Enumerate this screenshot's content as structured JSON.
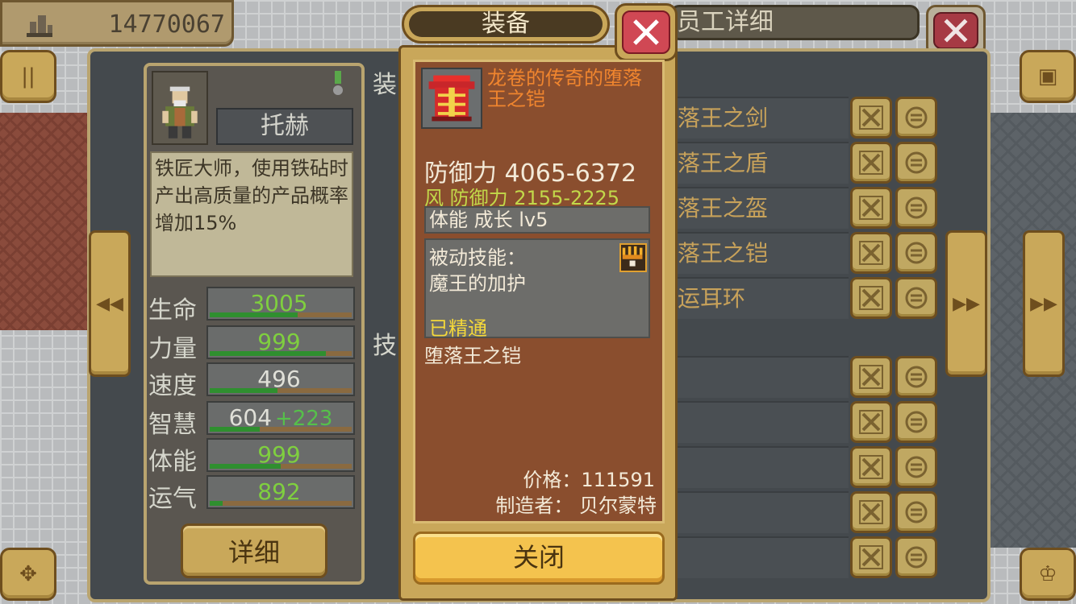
{
  "header": {
    "coins": "14770067",
    "right_panel_title": "员工详细"
  },
  "character": {
    "name": "托赫",
    "description": "铁匠大师，使用铁砧时产出高质量的产品概率增加15%",
    "stats": [
      {
        "label": "生命",
        "value": "3005",
        "bonus": "",
        "green": true,
        "fill": 0.62
      },
      {
        "label": "力量",
        "value": "999",
        "bonus": "",
        "green": true,
        "fill": 0.82
      },
      {
        "label": "速度",
        "value": "496",
        "bonus": "",
        "green": false,
        "fill": 0.48
      },
      {
        "label": "智慧",
        "value": "604",
        "bonus": "+223",
        "green": false,
        "fill": 0.35
      },
      {
        "label": "体能",
        "value": "999",
        "bonus": "",
        "green": true,
        "fill": 0.5
      },
      {
        "label": "运气",
        "value": "892",
        "bonus": "",
        "green": true,
        "fill": 0.09
      }
    ],
    "detail_button": "详细"
  },
  "sections": {
    "equipment_header": "装",
    "skills_header": "技"
  },
  "equipment_list": [
    "落王之剑",
    "落王之盾",
    "落王之盔",
    "落王之铠",
    "运耳环"
  ],
  "modal": {
    "title": "装备",
    "item_name": "龙卷的传奇的堕落王之铠",
    "defense_label": "防御力",
    "defense_value": "4065-6372",
    "wind_defense": "风 防御力 2155-2225",
    "growth": "体能 成长 lv5",
    "skill_title": "被动技能：",
    "skill_name": "魔王的加护",
    "skill_status": "已精通",
    "item_desc": "堕落王之铠",
    "price": "价格：111591",
    "maker": "制造者： 贝尔蒙特",
    "close_button": "关闭"
  },
  "colors": {
    "accent_gold": "#c9a85a",
    "item_name": "#f0852e",
    "mastered": "#f4d83a",
    "close_red": "#d04854"
  },
  "icons": {
    "coin": "building-coin-icon",
    "unequip": "unequip-x-icon",
    "swap": "swap-icon",
    "prev": "chevron-double-left-icon",
    "next": "chevron-double-right-icon"
  }
}
